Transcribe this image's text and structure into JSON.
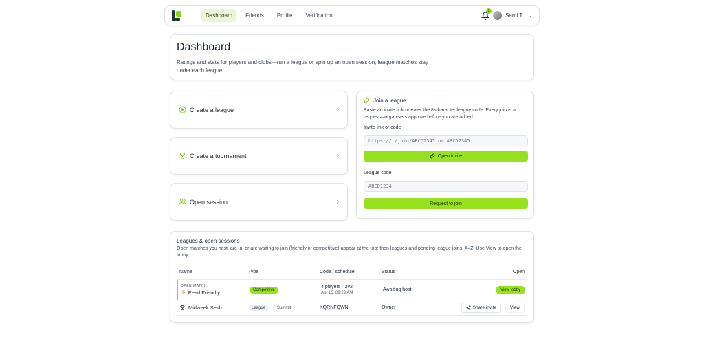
{
  "nav": {
    "links": [
      "Dashboard",
      "Friends",
      "Profile",
      "Verification"
    ],
    "active": "Dashboard",
    "notification_count": "1",
    "user_name": "Sami T"
  },
  "header": {
    "title": "Dashboard",
    "description": "Ratings and stats for players and clubs—run a league or spin up an open session; league matches stay under each league."
  },
  "actions": [
    {
      "label": "Create a league",
      "icon": "play-circle-icon"
    },
    {
      "label": "Create a tournament",
      "icon": "trophy-icon"
    },
    {
      "label": "Open session",
      "icon": "users-icon"
    }
  ],
  "join": {
    "title": "Join a league",
    "description": "Paste an invite link or enter the 8-character league code. Every join is a request—organisers approve before you are added.",
    "invite_label": "Invite link or code",
    "invite_placeholder": "https://…/join/ABCD2345 or ABCD2345",
    "open_invite_label": "Open invite",
    "code_label": "League code",
    "code_placeholder": "ABCD1234",
    "request_label": "Request to join"
  },
  "leagues": {
    "title": "Leagues & open sessions",
    "description": "Open matches you host, are in, or are waiting to join (friendly or competitive) appear at the top; then leagues and pending league joins, A–Z. Use View to open the lobby.",
    "columns": [
      "Name",
      "Type",
      "Code / schedule",
      "Status",
      "Open"
    ],
    "rows": [
      {
        "tag": "OPEN MATCH",
        "name": "Pearl Friendly",
        "type": "Competitive",
        "code": "4 players · 2v2",
        "schedule": "Apr 15, 09:29 AM",
        "status": "Awaiting host",
        "action": "View lobby"
      },
      {
        "name": "Midweek Sesh",
        "type": "League",
        "type2": "Summit",
        "code": "KQRNFQWN",
        "status": "Owner",
        "action1": "Share invite",
        "action2": "View"
      }
    ]
  },
  "colors": {
    "accent_green": "#96e21f",
    "open_match_stripe": "#f3a53b"
  }
}
